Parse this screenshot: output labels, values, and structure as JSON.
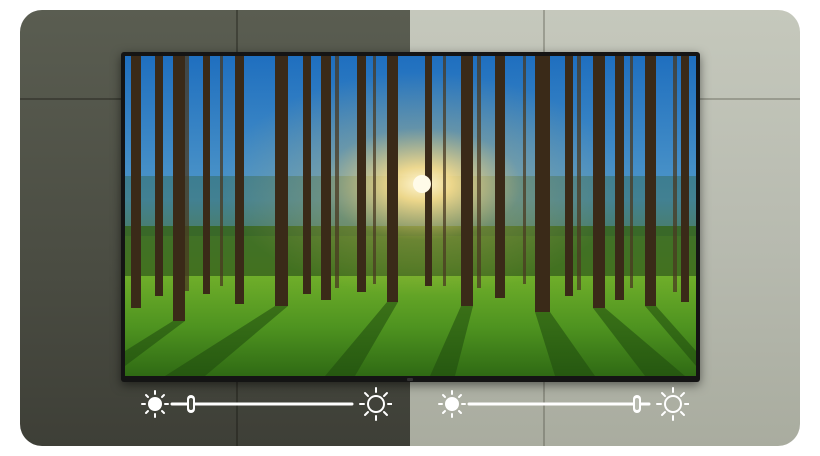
{
  "scene": {
    "description_icons": [
      "sun-dim-icon",
      "sun-bright-icon"
    ]
  },
  "left_control": {
    "level": 0.08,
    "mode": "dark-room"
  },
  "right_control": {
    "level": 0.92,
    "mode": "bright-room"
  },
  "colors": {
    "control": "#ffffff",
    "dark_wall": "#4a4c42",
    "light_wall": "#b7baaf"
  }
}
